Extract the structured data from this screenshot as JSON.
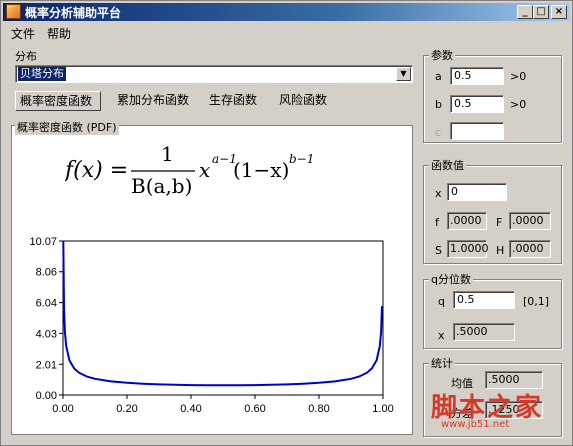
{
  "window": {
    "title": "概率分析辅助平台"
  },
  "menu": {
    "items": [
      "文件",
      "帮助"
    ]
  },
  "distribution": {
    "label": "分布",
    "selected": "贝塔分布"
  },
  "tabs": [
    "概率密度函数",
    "累加分布函数",
    "生存函数",
    "风险函数"
  ],
  "pdf": {
    "panel_title": "概率密度函数 (PDF)",
    "formula": {
      "lhs": "f(x) =",
      "numerator": "1",
      "denominator": "B(a,b)",
      "base1": "x",
      "exp1": "a−1",
      "base2": "(1−x)",
      "exp2": "b−1"
    }
  },
  "params": {
    "title": "参数",
    "a_label": "a",
    "a_value": "0.5",
    "a_constraint": ">0",
    "b_label": "b",
    "b_value": "0.5",
    "b_constraint": ">0",
    "c_label": "c",
    "c_value": ""
  },
  "funcvals": {
    "title": "函数值",
    "x_label": "x",
    "x_value": "0",
    "f_label": "f",
    "f_value": ".0000",
    "F_label": "F",
    "F_value": ".0000",
    "S_label": "S",
    "S_value": "1.0000",
    "H_label": "H",
    "H_value": ".0000"
  },
  "quantile": {
    "title": "q分位数",
    "q_label": "q",
    "q_value": "0.5",
    "q_range": "[0,1]",
    "x_label": "x",
    "x_value": ".5000"
  },
  "stats": {
    "title": "统计",
    "mean_label": "均值",
    "mean_value": ".5000",
    "var_label": "方差",
    "var_value": ".1250"
  },
  "watermark": {
    "text": "脚本之家",
    "url": "www.jb51.net"
  },
  "colors": {
    "curve": "#0000cc",
    "selection": "#0a246a",
    "title_start": "#0a246a",
    "title_end": "#a6caf0",
    "watermark": "#d43a2a"
  },
  "chart_data": {
    "type": "line",
    "title": "",
    "xlabel": "",
    "ylabel": "",
    "x_ticks": [
      "0.00",
      "0.20",
      "0.40",
      "0.60",
      "0.80",
      "1.00"
    ],
    "y_ticks": [
      "0.00",
      "2.01",
      "4.03",
      "6.04",
      "8.06",
      "10.07"
    ],
    "xlim": [
      0,
      1
    ],
    "ylim": [
      0,
      10.07
    ],
    "series": [
      {
        "x": [
          0.001,
          0.003,
          0.006,
          0.01,
          0.02,
          0.035,
          0.05,
          0.075,
          0.1,
          0.15,
          0.2,
          0.25,
          0.3,
          0.35,
          0.4,
          0.45,
          0.5,
          0.55,
          0.6,
          0.65,
          0.7,
          0.75,
          0.8,
          0.85,
          0.9,
          0.925,
          0.95,
          0.965,
          0.98,
          0.99,
          0.994,
          0.997
        ],
        "y": [
          10.07,
          5.81,
          4.12,
          3.2,
          2.27,
          1.73,
          1.46,
          1.2,
          1.06,
          0.89,
          0.8,
          0.74,
          0.69,
          0.67,
          0.65,
          0.64,
          0.64,
          0.64,
          0.65,
          0.67,
          0.69,
          0.74,
          0.8,
          0.89,
          1.06,
          1.2,
          1.46,
          1.73,
          2.27,
          3.2,
          4.12,
          5.81
        ]
      }
    ]
  }
}
